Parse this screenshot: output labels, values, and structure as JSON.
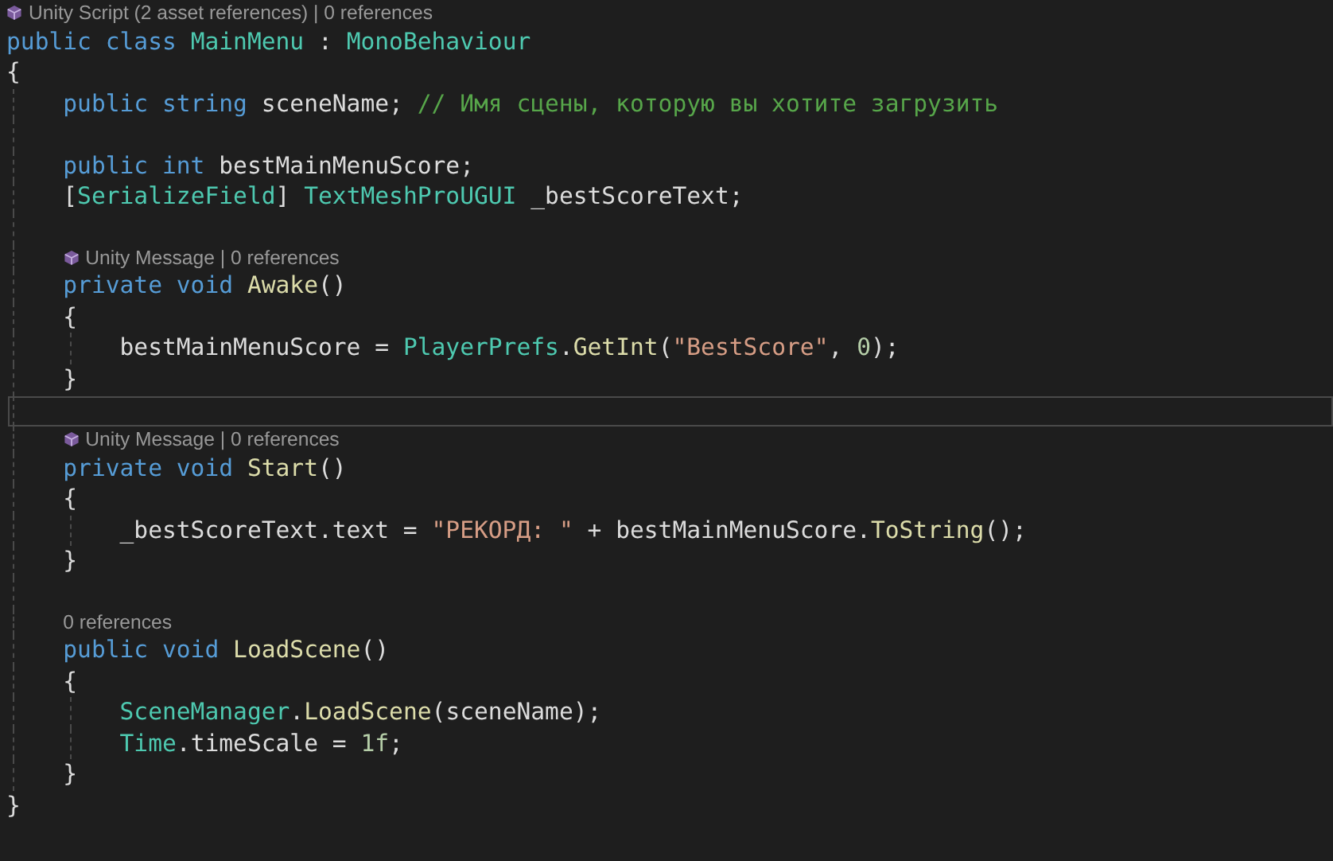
{
  "editor": {
    "lines": [
      {
        "kind": "lens",
        "icon": true,
        "text": "Unity Script (2 asset references) | 0 references",
        "current": false
      },
      {
        "kind": "code",
        "current": false,
        "tokens": [
          {
            "text": "public class ",
            "kind": "kw"
          },
          {
            "text": "MainMenu",
            "kind": "type"
          },
          {
            "text": " : ",
            "kind": "plain"
          },
          {
            "text": "MonoBehaviour",
            "kind": "type"
          }
        ]
      },
      {
        "kind": "code",
        "current": false,
        "tokens": [
          {
            "text": "{",
            "kind": "plain"
          }
        ],
        "children": [
          {
            "kind": "code",
            "current": false,
            "tokens": [
              {
                "text": "public string ",
                "kind": "kw"
              },
              {
                "text": "sceneName; ",
                "kind": "plain"
              },
              {
                "text": "// Имя сцены, которую вы хотите загрузить",
                "kind": "comment"
              }
            ]
          },
          {
            "kind": "blank",
            "current": false
          },
          {
            "kind": "code",
            "current": false,
            "tokens": [
              {
                "text": "public int ",
                "kind": "kw"
              },
              {
                "text": "bestMainMenuScore;",
                "kind": "plain"
              }
            ]
          },
          {
            "kind": "code",
            "current": false,
            "tokens": [
              {
                "text": "[",
                "kind": "plain"
              },
              {
                "text": "SerializeField",
                "kind": "type"
              },
              {
                "text": "] ",
                "kind": "plain"
              },
              {
                "text": "TextMeshProUGUI",
                "kind": "type"
              },
              {
                "text": " _bestScoreText;",
                "kind": "plain"
              }
            ]
          },
          {
            "kind": "blank",
            "current": false
          },
          {
            "kind": "lens",
            "icon": true,
            "text": "Unity Message | 0 references",
            "current": false
          },
          {
            "kind": "code",
            "current": false,
            "tokens": [
              {
                "text": "private void ",
                "kind": "kw"
              },
              {
                "text": "Awake",
                "kind": "method"
              },
              {
                "text": "()",
                "kind": "plain"
              }
            ]
          },
          {
            "kind": "code",
            "current": false,
            "tokens": [
              {
                "text": "{",
                "kind": "plain"
              }
            ],
            "children": [
              {
                "kind": "code",
                "current": false,
                "tokens": [
                  {
                    "text": "bestMainMenuScore = ",
                    "kind": "plain"
                  },
                  {
                    "text": "PlayerPrefs",
                    "kind": "type"
                  },
                  {
                    "text": ".",
                    "kind": "plain"
                  },
                  {
                    "text": "GetInt",
                    "kind": "method"
                  },
                  {
                    "text": "(",
                    "kind": "plain"
                  },
                  {
                    "text": "\"BestScore\"",
                    "kind": "string"
                  },
                  {
                    "text": ", ",
                    "kind": "plain"
                  },
                  {
                    "text": "0",
                    "kind": "number"
                  },
                  {
                    "text": ");",
                    "kind": "plain"
                  }
                ]
              }
            ]
          },
          {
            "kind": "code",
            "current": false,
            "tokens": [
              {
                "text": "}",
                "kind": "plain"
              }
            ]
          },
          {
            "kind": "blank",
            "current": true
          },
          {
            "kind": "lens",
            "icon": true,
            "text": "Unity Message | 0 references",
            "current": false
          },
          {
            "kind": "code",
            "current": false,
            "tokens": [
              {
                "text": "private void ",
                "kind": "kw"
              },
              {
                "text": "Start",
                "kind": "method"
              },
              {
                "text": "()",
                "kind": "plain"
              }
            ]
          },
          {
            "kind": "code",
            "current": false,
            "tokens": [
              {
                "text": "{",
                "kind": "plain"
              }
            ],
            "children": [
              {
                "kind": "code",
                "current": false,
                "tokens": [
                  {
                    "text": "_bestScoreText.text = ",
                    "kind": "plain"
                  },
                  {
                    "text": "\"РЕКОРД: \"",
                    "kind": "string"
                  },
                  {
                    "text": " + bestMainMenuScore.",
                    "kind": "plain"
                  },
                  {
                    "text": "ToString",
                    "kind": "method"
                  },
                  {
                    "text": "();",
                    "kind": "plain"
                  }
                ]
              }
            ]
          },
          {
            "kind": "code",
            "current": false,
            "tokens": [
              {
                "text": "}",
                "kind": "plain"
              }
            ]
          },
          {
            "kind": "blank",
            "current": false
          },
          {
            "kind": "lens",
            "icon": false,
            "text": "0 references",
            "current": false
          },
          {
            "kind": "code",
            "current": false,
            "tokens": [
              {
                "text": "public void ",
                "kind": "kw"
              },
              {
                "text": "LoadScene",
                "kind": "method"
              },
              {
                "text": "()",
                "kind": "plain"
              }
            ]
          },
          {
            "kind": "code",
            "current": false,
            "tokens": [
              {
                "text": "{",
                "kind": "plain"
              }
            ],
            "children": [
              {
                "kind": "code",
                "current": false,
                "tokens": [
                  {
                    "text": "SceneManager",
                    "kind": "type"
                  },
                  {
                    "text": ".",
                    "kind": "plain"
                  },
                  {
                    "text": "LoadScene",
                    "kind": "method"
                  },
                  {
                    "text": "(sceneName);",
                    "kind": "plain"
                  }
                ]
              },
              {
                "kind": "code",
                "current": false,
                "tokens": [
                  {
                    "text": "Time",
                    "kind": "type"
                  },
                  {
                    "text": ".timeScale = ",
                    "kind": "plain"
                  },
                  {
                    "text": "1f",
                    "kind": "number"
                  },
                  {
                    "text": ";",
                    "kind": "plain"
                  }
                ]
              }
            ]
          },
          {
            "kind": "code",
            "current": false,
            "tokens": [
              {
                "text": "}",
                "kind": "plain"
              }
            ]
          }
        ]
      },
      {
        "kind": "code",
        "current": false,
        "tokens": [
          {
            "text": "}",
            "kind": "plain"
          }
        ]
      }
    ]
  }
}
